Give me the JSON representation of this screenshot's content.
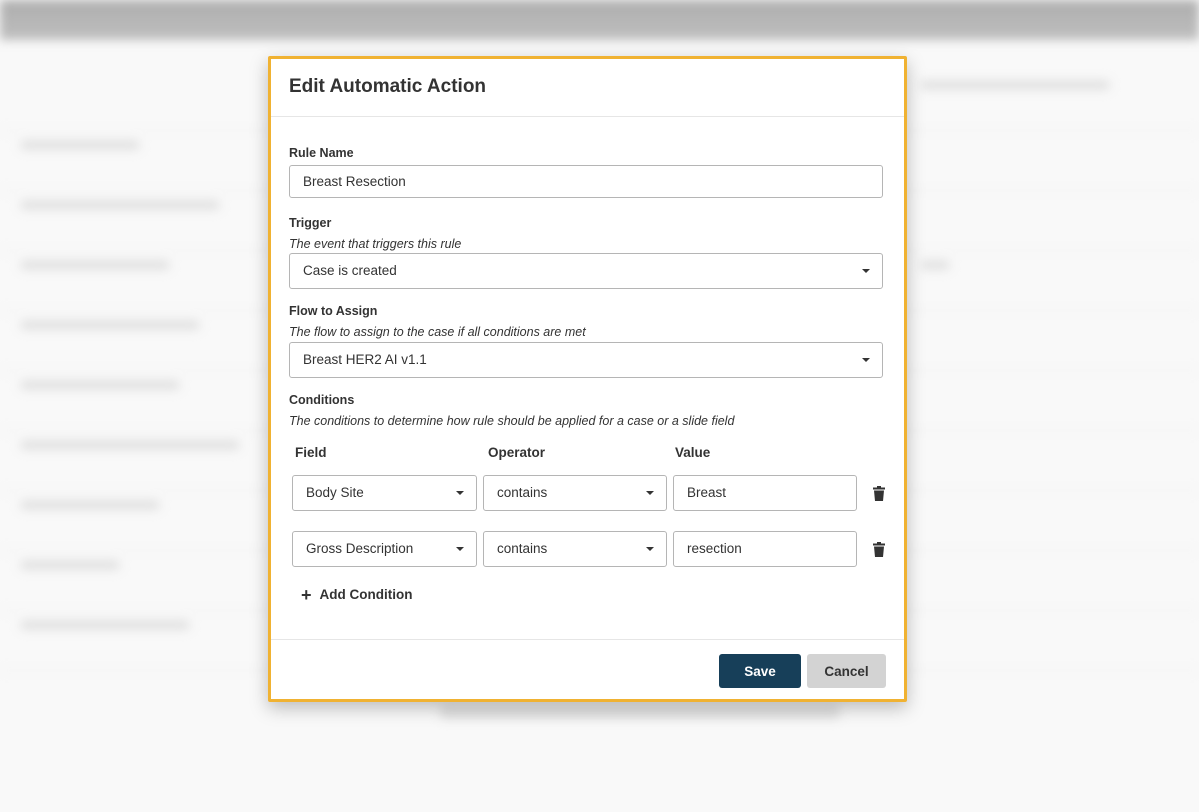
{
  "modal": {
    "title": "Edit Automatic Action",
    "rule_name": {
      "label": "Rule Name",
      "value": "Breast Resection"
    },
    "trigger": {
      "label": "Trigger",
      "help": "The event that triggers this rule",
      "value": "Case is created"
    },
    "flow": {
      "label": "Flow to Assign",
      "help": "The flow to assign to the case if all conditions are met",
      "value": "Breast HER2 AI v1.1"
    },
    "conditions": {
      "label": "Conditions",
      "help": "The conditions to determine how rule should be applied for a case or a slide field",
      "columns": {
        "field": "Field",
        "operator": "Operator",
        "value": "Value"
      },
      "rows": [
        {
          "field": "Body Site",
          "operator": "contains",
          "value": "Breast"
        },
        {
          "field": "Gross Description",
          "operator": "contains",
          "value": "resection"
        }
      ],
      "add_label": "Add Condition"
    },
    "footer": {
      "save_label": "Save",
      "cancel_label": "Cancel"
    }
  },
  "colors": {
    "accent_border": "#f0b232",
    "primary_button": "#173f59",
    "secondary_button": "#d3d3d3"
  },
  "icons": {
    "trash": "trash-icon",
    "caret": "caret-down-icon",
    "plus": "plus-icon"
  }
}
